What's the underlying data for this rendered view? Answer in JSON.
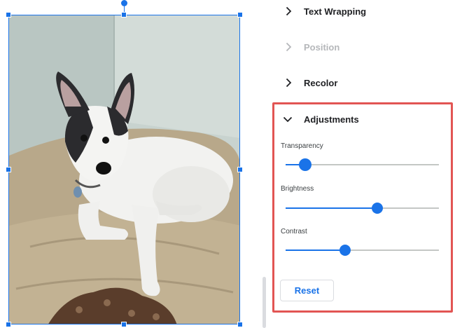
{
  "colors": {
    "accent": "#1a73e8",
    "highlight_border": "#e25553",
    "section_text": "#202124",
    "disabled_text": "#b5b7ba"
  },
  "image": {
    "subject": "dog-photo"
  },
  "panel": {
    "sections": [
      {
        "label": "Text Wrapping",
        "icon": "chevron-right-icon",
        "state": "collapsed"
      },
      {
        "label": "Position",
        "icon": "chevron-right-icon",
        "state": "disabled"
      },
      {
        "label": "Recolor",
        "icon": "chevron-right-icon",
        "state": "collapsed"
      }
    ],
    "adjustments": {
      "title": "Adjustments",
      "icon": "chevron-down-icon",
      "state": "expanded",
      "sliders": [
        {
          "label": "Transparency",
          "value": 0.13
        },
        {
          "label": "Brightness",
          "value": 0.6
        },
        {
          "label": "Contrast",
          "value": 0.39
        }
      ],
      "reset_label": "Reset"
    }
  }
}
